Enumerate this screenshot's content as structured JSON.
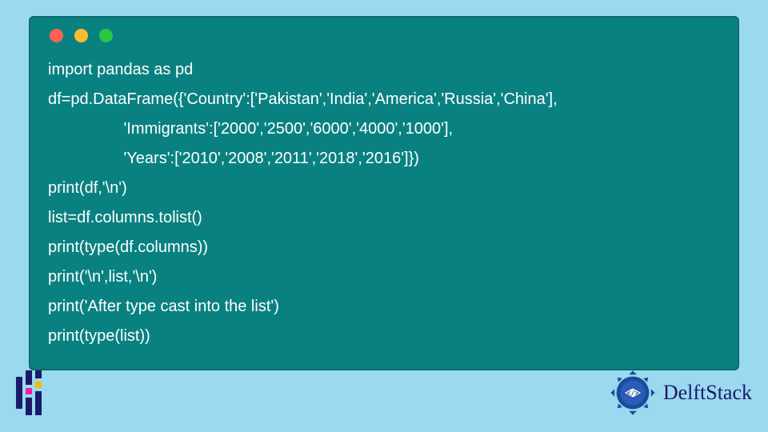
{
  "card": {
    "traffic_lights": [
      "red",
      "yellow",
      "green"
    ]
  },
  "code": {
    "lines": [
      "import pandas as pd",
      "df=pd.DataFrame({'Country':['Pakistan','India','America','Russia','China'],",
      "                 'Immigrants':['2000','2500','6000','4000','1000'],",
      "                 'Years':['2010','2008','2011','2018','2016']})",
      "print(df,'\\n')",
      "list=df.columns.tolist()",
      "print(type(df.columns))",
      "print('\\n',list,'\\n')",
      "print('After type cast into the list')",
      "print(type(list))"
    ]
  },
  "footer": {
    "brand": "DelftStack"
  },
  "colors": {
    "page_bg": "#9ad9ef",
    "card_bg": "#0a8181",
    "code_text": "#ffffff",
    "brand_navy": "#1a1a6b"
  }
}
